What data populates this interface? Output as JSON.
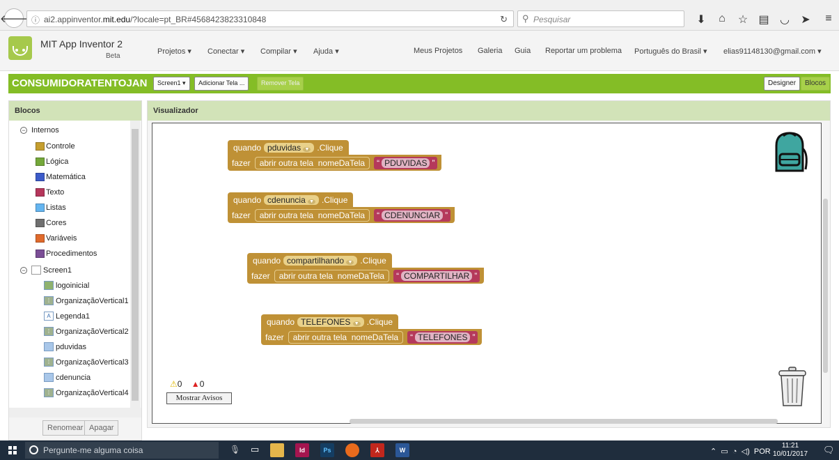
{
  "browser": {
    "url_prefix": "ai2.appinventor.",
    "url_domain": "mit.edu",
    "url_suffix": "/?locale=pt_BR#4568423823310848",
    "search_placeholder": "Pesquisar"
  },
  "app": {
    "title": "MIT App Inventor 2",
    "subtitle": "Beta",
    "menu": [
      "Projetos ▾",
      "Conectar ▾",
      "Compilar ▾",
      "Ajuda ▾"
    ],
    "links": [
      "Meus Projetos",
      "Galeria",
      "Guia",
      "Reportar um problema",
      "Português do Brasil ▾",
      "elias91148130@gmail.com ▾"
    ]
  },
  "project": {
    "name": "CONSUMIDORATENTOJAN",
    "screen_select": "Screen1 ▾",
    "add_screen": "Adicionar Tela ...",
    "remove_screen": "Remover Tela",
    "designer": "Designer",
    "blocks": "Blocos"
  },
  "left_panel": {
    "title": "Blocos",
    "builtin": "Internos",
    "categories": [
      {
        "label": "Controle",
        "color": "#c59e2f"
      },
      {
        "label": "Lógica",
        "color": "#74a83a"
      },
      {
        "label": "Matemática",
        "color": "#3c5bc9"
      },
      {
        "label": "Texto",
        "color": "#b5365b"
      },
      {
        "label": "Listas",
        "color": "#64b5f0"
      },
      {
        "label": "Cores",
        "color": "#6f6f6f"
      },
      {
        "label": "Variáveis",
        "color": "#e06a2c"
      },
      {
        "label": "Procedimentos",
        "color": "#7b4e96"
      }
    ],
    "screen": "Screen1",
    "components": [
      "logoinicial",
      "OrganizaçãoVertical1",
      "Legenda1",
      "OrganizaçãoVertical2",
      "pduvidas",
      "OrganizaçãoVertical3",
      "cdenuncia",
      "OrganizaçãoVertical4"
    ],
    "rename": "Renomear",
    "delete": "Apagar"
  },
  "viewer": {
    "title": "Visualizador",
    "when": "quando",
    "click": ".Clique",
    "do": "fazer",
    "open_screen": "abrir outra tela",
    "screen_name": "nomeDaTela",
    "blocks": [
      {
        "component": "pduvidas",
        "screen": "PDUVIDAS"
      },
      {
        "component": "cdenuncia",
        "screen": "CDENUNCIAR"
      },
      {
        "component": "compartilhando",
        "screen": "COMPARTILHAR"
      },
      {
        "component": "TELEFONES",
        "screen": "TELEFONES"
      }
    ],
    "warnings_count": "0",
    "errors_count": "0",
    "show_warnings": "Mostrar Avisos"
  },
  "taskbar": {
    "search": "Pergunte-me alguma coisa",
    "lang": "POR",
    "time": "11:21",
    "date": "10/01/2017"
  }
}
